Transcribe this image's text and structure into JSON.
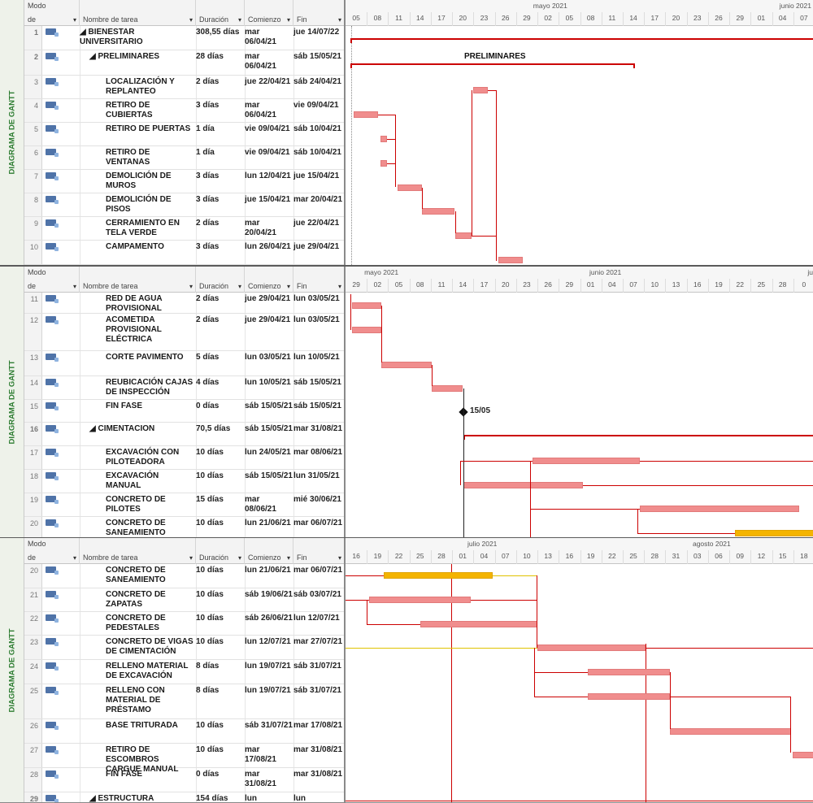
{
  "view_label": "DIAGRAMA DE GANTT",
  "columns": {
    "mode_l1": "Modo",
    "mode_l2": "de",
    "name": "Nombre de tarea",
    "duration": "Duración",
    "start": "Comienzo",
    "finish": "Fin"
  },
  "panel1": {
    "timeline": {
      "months": [
        {
          "label": "mayo 2021",
          "pos": 0.4
        },
        {
          "label": "junio 2021",
          "pos": 0.925
        }
      ],
      "days": [
        "05",
        "08",
        "11",
        "14",
        "17",
        "20",
        "23",
        "26",
        "29",
        "02",
        "05",
        "08",
        "11",
        "14",
        "17",
        "20",
        "23",
        "26",
        "29",
        "01",
        "04",
        "07"
      ]
    },
    "rows": [
      {
        "id": "1",
        "name": "◢ BIENESTAR UNIVERSITARIO",
        "dur": "308,55 días",
        "st": "mar 06/04/21",
        "fn": "jue 14/07/22",
        "summary": true
      },
      {
        "id": "2",
        "name": "◢ PRELIMINARES",
        "dur": "28 días",
        "st": "mar 06/04/21",
        "fn": "sáb 15/05/21",
        "summary": true
      },
      {
        "id": "3",
        "name": "LOCALIZACIÓN Y REPLANTEO",
        "dur": "2 días",
        "st": "jue 22/04/21",
        "fn": "sáb 24/04/21"
      },
      {
        "id": "4",
        "name": "RETIRO DE CUBIERTAS",
        "dur": "3 días",
        "st": "mar 06/04/21",
        "fn": "vie 09/04/21"
      },
      {
        "id": "5",
        "name": "RETIRO DE PUERTAS",
        "dur": "1 día",
        "st": "vie 09/04/21",
        "fn": "sáb 10/04/21"
      },
      {
        "id": "6",
        "name": "RETIRO DE VENTANAS",
        "dur": "1 día",
        "st": "vie 09/04/21",
        "fn": "sáb 10/04/21"
      },
      {
        "id": "7",
        "name": "DEMOLICIÓN DE MUROS",
        "dur": "3 días",
        "st": "lun 12/04/21",
        "fn": "jue 15/04/21"
      },
      {
        "id": "8",
        "name": "DEMOLICIÓN DE PISOS",
        "dur": "3 días",
        "st": "jue 15/04/21",
        "fn": "mar 20/04/21"
      },
      {
        "id": "9",
        "name": "CERRAMIENTO EN TELA VERDE",
        "dur": "2 días",
        "st": "mar 20/04/21",
        "fn": "jue 22/04/21"
      },
      {
        "id": "10",
        "name": "CAMPAMENTO",
        "dur": "3 días",
        "st": "lun 26/04/21",
        "fn": "jue 29/04/21"
      }
    ],
    "summary_label": "PRELIMINARES"
  },
  "panel2": {
    "timeline": {
      "months": [
        {
          "label": "mayo 2021",
          "pos": 0.04
        },
        {
          "label": "junio 2021",
          "pos": 0.52
        },
        {
          "label": "jul",
          "pos": 0.985
        }
      ],
      "days": [
        "29",
        "02",
        "05",
        "08",
        "11",
        "14",
        "17",
        "20",
        "23",
        "26",
        "29",
        "01",
        "04",
        "07",
        "10",
        "13",
        "16",
        "19",
        "22",
        "25",
        "28",
        "0"
      ]
    },
    "rows": [
      {
        "id": "11",
        "name": "RED DE AGUA PROVISIONAL",
        "dur": "2 días",
        "st": "jue 29/04/21",
        "fn": "lun 03/05/21"
      },
      {
        "id": "12",
        "name": "ACOMETIDA PROVISIONAL ELÉCTRICA",
        "dur": "2 días",
        "st": "jue 29/04/21",
        "fn": "lun 03/05/21"
      },
      {
        "id": "13",
        "name": "CORTE PAVIMENTO",
        "dur": "5 días",
        "st": "lun 03/05/21",
        "fn": "lun 10/05/21"
      },
      {
        "id": "14",
        "name": "REUBICACIÓN CAJAS DE INSPECCIÓN",
        "dur": "4 días",
        "st": "lun 10/05/21",
        "fn": "sáb 15/05/21"
      },
      {
        "id": "15",
        "name": "FIN FASE",
        "dur": "0 días",
        "st": "sáb 15/05/21",
        "fn": "sáb 15/05/21"
      },
      {
        "id": "16",
        "name": "◢ CIMENTACION",
        "dur": "70,5 días",
        "st": "sáb 15/05/21",
        "fn": "mar 31/08/21",
        "summary": true
      },
      {
        "id": "17",
        "name": "EXCAVACIÓN CON PILOTEADORA",
        "dur": "10 días",
        "st": "lun 24/05/21",
        "fn": "mar 08/06/21"
      },
      {
        "id": "18",
        "name": "EXCAVACIÓN MANUAL",
        "dur": "10 días",
        "st": "sáb 15/05/21",
        "fn": "lun 31/05/21"
      },
      {
        "id": "19",
        "name": "CONCRETO DE PILOTES",
        "dur": "15 días",
        "st": "mar 08/06/21",
        "fn": "mié 30/06/21"
      },
      {
        "id": "20",
        "name": "CONCRETO DE SANEAMIENTO",
        "dur": "10 días",
        "st": "lun 21/06/21",
        "fn": "mar 06/07/21"
      }
    ],
    "milestone_label": "15/05"
  },
  "panel3": {
    "timeline": {
      "months": [
        {
          "label": "julio 2021",
          "pos": 0.26
        },
        {
          "label": "agosto 2021",
          "pos": 0.74
        }
      ],
      "days": [
        "16",
        "19",
        "22",
        "25",
        "28",
        "01",
        "04",
        "07",
        "10",
        "13",
        "16",
        "19",
        "22",
        "25",
        "28",
        "31",
        "03",
        "06",
        "09",
        "12",
        "15",
        "18"
      ]
    },
    "rows": [
      {
        "id": "20",
        "name": "CONCRETO DE SANEAMIENTO",
        "dur": "10 días",
        "st": "lun 21/06/21",
        "fn": "mar 06/07/21"
      },
      {
        "id": "21",
        "name": "CONCRETO DE ZAPATAS",
        "dur": "10 días",
        "st": "sáb 19/06/21",
        "fn": "sáb 03/07/21"
      },
      {
        "id": "22",
        "name": "CONCRETO DE PEDESTALES",
        "dur": "10 días",
        "st": "sáb 26/06/21",
        "fn": "lun 12/07/21"
      },
      {
        "id": "23",
        "name": "CONCRETO DE VIGAS DE CIMENTACIÓN",
        "dur": "10 días",
        "st": "lun 12/07/21",
        "fn": "mar 27/07/21"
      },
      {
        "id": "24",
        "name": "RELLENO MATERIAL DE EXCAVACIÓN",
        "dur": "8 días",
        "st": "lun 19/07/21",
        "fn": "sáb 31/07/21"
      },
      {
        "id": "25",
        "name": "RELLENO CON MATERIAL DE PRÉSTAMO",
        "dur": "8 días",
        "st": "lun 19/07/21",
        "fn": "sáb 31/07/21"
      },
      {
        "id": "26",
        "name": "BASE TRITURADA",
        "dur": "10 días",
        "st": "sáb 31/07/21",
        "fn": "mar 17/08/21"
      },
      {
        "id": "27",
        "name": "RETIRO DE ESCOMBROS CARGUE MANUAL",
        "dur": "10 días",
        "st": "mar 17/08/21",
        "fn": "mar 31/08/21"
      },
      {
        "id": "28",
        "name": "FIN FASE",
        "dur": "0 días",
        "st": "mar 31/08/21",
        "fn": "mar 31/08/21"
      },
      {
        "id": "29",
        "name": "◢ ESTRUCTURA",
        "dur": "154 días",
        "st": "lun",
        "fn": "lun",
        "summary": true
      }
    ]
  }
}
